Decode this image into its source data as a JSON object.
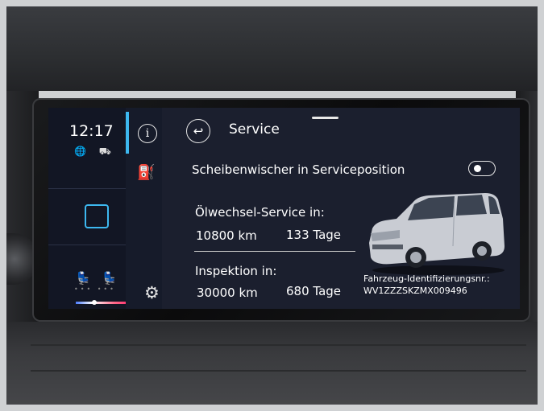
{
  "status": {
    "clock": "12:17",
    "status_icons": "🌐 ⛟",
    "seat_icons": "💺💺",
    "seat_dots": "••• •••"
  },
  "side_icons": {
    "info": "i",
    "gauge": "⛽",
    "gear": "⚙"
  },
  "header": {
    "back_symbol": "↩",
    "title": "Service"
  },
  "wiper": {
    "label": "Scheibenwischer in Serviceposition",
    "toggle_on": false
  },
  "oil_service": {
    "label": "Ölwechsel-Service in:",
    "km": "10800 km",
    "days": "133 Tage"
  },
  "inspection": {
    "label": "Inspektion in:",
    "km": "30000 km",
    "days": "680 Tage"
  },
  "vehicle": {
    "vin_label": "Fahrzeug-Identifizierungsnr.:",
    "vin": "WV1ZZZSKZMX009496"
  },
  "colors": {
    "accent": "#3db8f0",
    "screen_bg": "#1b1f2e"
  }
}
